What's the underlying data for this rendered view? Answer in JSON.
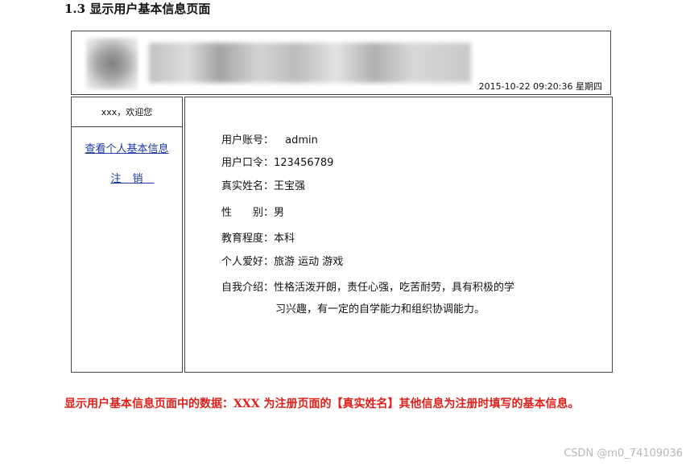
{
  "section_heading": "1.3  显示用户基本信息页面",
  "banner": {
    "datetime": "2015-10-22 09:20:36 星期四"
  },
  "sidebar": {
    "welcome": "xxx，欢迎您",
    "view_info_link": "查看个人基本信息",
    "logout_link": "注销"
  },
  "user_info": {
    "account_label": "用户账号：",
    "account_value": "admin",
    "password_label": "用户口令：",
    "password_value": "123456789",
    "realname_label": "真实姓名：",
    "realname_value": "王宝强",
    "gender_label": "性　　别：",
    "gender_value": "男",
    "education_label": "教育程度：",
    "education_value": "本科",
    "hobby_label": "个人爱好：",
    "hobby_value": "旅游  运动  游戏",
    "intro_label": "自我介绍：",
    "intro_line1": "性格活泼开朗，责任心强，吃苦耐劳，具有积极的学",
    "intro_line2": "习兴趣，有一定的自学能力和组织协调能力。"
  },
  "note": "显示用户基本信息页面中的数据：XXX 为注册页面的【真实姓名】其他信息为注册时填写的基本信息。",
  "watermark": "CSDN @m0_74109036"
}
